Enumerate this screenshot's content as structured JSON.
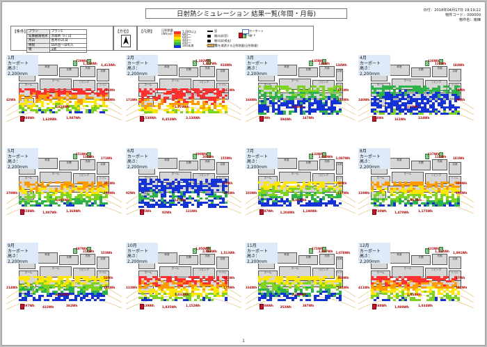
{
  "header": {
    "title": "日射熱シミュレーション 結果一覧(年間・月毎)",
    "date": "日付：2018年04月17日 19:19:22",
    "code": "物件コード：000000",
    "name": "物件名：南棟"
  },
  "conditions": {
    "label": "【条件】",
    "rows": [
      {
        "key": "プラン",
        "value": "プラン1"
      },
      {
        "key": "気象観測地点",
        "value": "茨城県 つくば"
      },
      {
        "key": "月日",
        "value": "各月の21日"
      },
      {
        "key": "時刻",
        "value": "日の出〜日の入"
      },
      {
        "key": "階",
        "value": "1階"
      }
    ]
  },
  "compass": {
    "label": "【方位】",
    "north": "N"
  },
  "legend": {
    "label": "【凡例】",
    "scale_title": "日射熱量",
    "scale_unit": "(Wh/㎡)",
    "scale_values": [
      "1,000以上",
      "800〜",
      "600〜",
      "400〜",
      "200〜",
      "200未満"
    ],
    "scale_colors": [
      "#ff3030",
      "#ff9a00",
      "#ffe600",
      "#7ed321",
      "#2db34a",
      "#1433d6"
    ],
    "items": [
      "窓",
      "開口部(窓)",
      "開口部(掃出)",
      "庇",
      "カーポート",
      "木",
      "窓を通過する日射熱量(日射熱量)",
      "ポイント"
    ]
  },
  "months": [
    {
      "label": "1月",
      "carport": "カーポート",
      "height": "高さ：2,200mm",
      "labels": [
        "1,388Wh",
        "1,639Wh",
        "1,087Wh",
        "1,020Wh",
        "1,779Wh",
        "1,413Wh",
        "729Wh",
        "42Wh",
        "424Wh",
        "133Wh"
      ]
    },
    {
      "label": "2月",
      "carport": "カーポート",
      "height": "高さ：2,200mm",
      "labels": [
        "10,530Wh",
        "8,453Wh",
        "3,130Wh",
        "1,779Wh",
        "1,427Wh",
        "818Wh",
        "1,102Wh",
        "171Wh",
        "161Wh"
      ]
    },
    {
      "label": "3月",
      "carport": "カーポート",
      "height": "高さ：2,200mm",
      "labels": [
        "580Wh",
        "394Wh",
        "247Wh",
        "314Wh",
        "126Wh",
        "134Wh",
        "135Wh",
        "168Wh",
        "171Wh",
        "173Wh"
      ]
    },
    {
      "label": "4月",
      "carport": "カーポート",
      "height": "高さ：2,200mm",
      "labels": [
        "174Wh",
        "161Wh",
        "124Wh",
        "117Wh",
        "132Wh",
        "184Wh",
        "130Wh",
        "140Wh",
        "79Wh",
        "99Wh"
      ]
    },
    {
      "label": "5月",
      "carport": "カーポート",
      "height": "高さ：2,200mm",
      "labels": [
        "3,558Wh",
        "1,087Wh",
        "1,369Wh",
        "1,060Wh",
        "130Wh",
        "171Wh",
        "151Wh",
        "378Wh",
        "351Wh",
        "193Wh"
      ]
    },
    {
      "label": "6月",
      "carport": "カーポート",
      "height": "高さ：2,200mm",
      "labels": [
        "135Wh",
        "92Wh",
        "131Wh",
        "127Wh",
        "203Wh",
        "155Wh",
        "190Wh",
        "92Wh",
        "93Wh",
        "171Wh"
      ]
    },
    {
      "label": "7月",
      "carport": "カーポート",
      "height": "高さ：2,200mm",
      "labels": [
        "1,187Wh",
        "1,204Wh",
        "1,198Wh",
        "1,033Wh",
        "1,080Wh",
        "1,087Wh",
        "133Wh",
        "103Wh",
        "98Wh",
        "117Wh"
      ]
    },
    {
      "label": "8月",
      "carport": "カーポート",
      "height": "高さ：2,200mm",
      "labels": [
        "1,730Wh",
        "1,470Wh",
        "1,175Wh",
        "1,003Wh",
        "112Wh",
        "181Wh",
        "137Wh",
        "319Wh",
        "349Wh",
        "165Wh"
      ]
    },
    {
      "label": "9月",
      "carport": "カーポート",
      "height": "高さ：2,200mm",
      "labels": [
        "1,297Wh",
        "432Wh",
        "382Wh",
        "1,033Wh",
        "211Wh",
        "153Wh",
        "187Wh",
        "214Wh",
        "52Wh",
        "191Wh"
      ]
    },
    {
      "label": "10月",
      "carport": "カーポート",
      "height": "高さ：2,200mm",
      "labels": [
        "4,139Wh",
        "1,835Wh",
        "1,152Wh",
        "1,033Wh",
        "2,094Wh",
        "1,513Wh",
        "1,050Wh",
        "113Wh",
        "241Wh",
        "175Wh"
      ]
    },
    {
      "label": "11月",
      "carport": "カーポート",
      "height": "高さ：2,200mm",
      "labels": [
        "1,808Wh",
        "353Wh",
        "387Wh",
        "2,088Wh",
        "1,097Wh",
        "1,078Wh",
        "171Wh",
        "334Wh",
        "368Wh",
        "191Wh"
      ]
    },
    {
      "label": "12月",
      "carport": "カーポート",
      "height": "高さ：2,200mm",
      "labels": [
        "1,288Wh",
        "1,089Wh",
        "1,034Wh",
        "1,058Wh",
        "1,112Wh",
        "1,091Wh",
        "123Wh",
        "411Wh",
        "47Wh",
        "194Wh"
      ]
    }
  ],
  "rooms": [
    "洋室",
    "玄関",
    "ホール",
    "リビング",
    "和室",
    "浴室",
    "洗面",
    "納戸",
    "トイレ"
  ],
  "page_number": "1"
}
